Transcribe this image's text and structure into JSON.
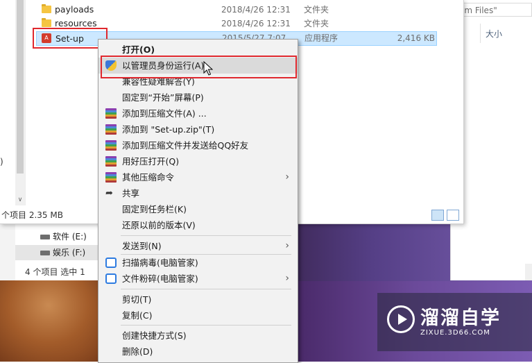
{
  "files": [
    {
      "name": "payloads",
      "date": "2018/4/26 12:31",
      "type": "文件夹",
      "size": "",
      "kind": "folder"
    },
    {
      "name": "resources",
      "date": "2018/4/26 12:31",
      "type": "文件夹",
      "size": "",
      "kind": "folder"
    },
    {
      "name": "Set-up",
      "date": "2015/5/27 7:07",
      "type": "应用程序",
      "size": "2,416 KB",
      "kind": "exe"
    }
  ],
  "nav_pane": {
    "fragment": ")"
  },
  "status_bar": {
    "text": "个项目  2.35 MB"
  },
  "right_window": {
    "search_text": "am Files\"",
    "column_header": "大小"
  },
  "back_window": {
    "drives": [
      {
        "label": "软件 (E:)"
      },
      {
        "label": "娱乐 (F:)"
      }
    ],
    "status": "4 个项目    选中 1"
  },
  "context_menu": {
    "items": [
      {
        "label": "打开(O)",
        "bold": true
      },
      {
        "label": "以管理员身份运行(A)",
        "icon": "uac-shield-icon"
      },
      {
        "label": "兼容性疑难解答(Y)"
      },
      {
        "label": "固定到“开始”屏幕(P)"
      },
      {
        "label": "添加到压缩文件(A) ...",
        "icon": "winrar-icon"
      },
      {
        "label": "添加到 \"Set-up.zip\"(T)",
        "icon": "winrar-icon"
      },
      {
        "label": "添加到压缩文件并发送给QQ好友",
        "icon": "winrar-icon"
      },
      {
        "label": "用好压打开(Q)",
        "icon": "winrar-icon"
      },
      {
        "label": "其他压缩命令",
        "icon": "winrar-icon",
        "submenu": true
      },
      {
        "label": "共享",
        "icon": "share-icon"
      },
      {
        "label": "固定到任务栏(K)"
      },
      {
        "label": "还原以前的版本(V)"
      },
      {
        "label": "发送到(N)",
        "submenu": true
      },
      {
        "label": "扫描病毒(电脑管家)",
        "icon": "pc-manager-icon"
      },
      {
        "label": "文件粉碎(电脑管家)",
        "icon": "pc-manager-icon",
        "submenu": true
      },
      {
        "label": "剪切(T)"
      },
      {
        "label": "复制(C)"
      },
      {
        "label": "创建快捷方式(S)"
      },
      {
        "label": "删除(D)"
      }
    ]
  },
  "watermark": {
    "title": "溜溜自学",
    "url": "ZIXUE.3D66.COM"
  },
  "colors": {
    "highlight_box": "#e0282e",
    "selection": "#cce8ff",
    "menu_bg": "#f2f2f2"
  }
}
